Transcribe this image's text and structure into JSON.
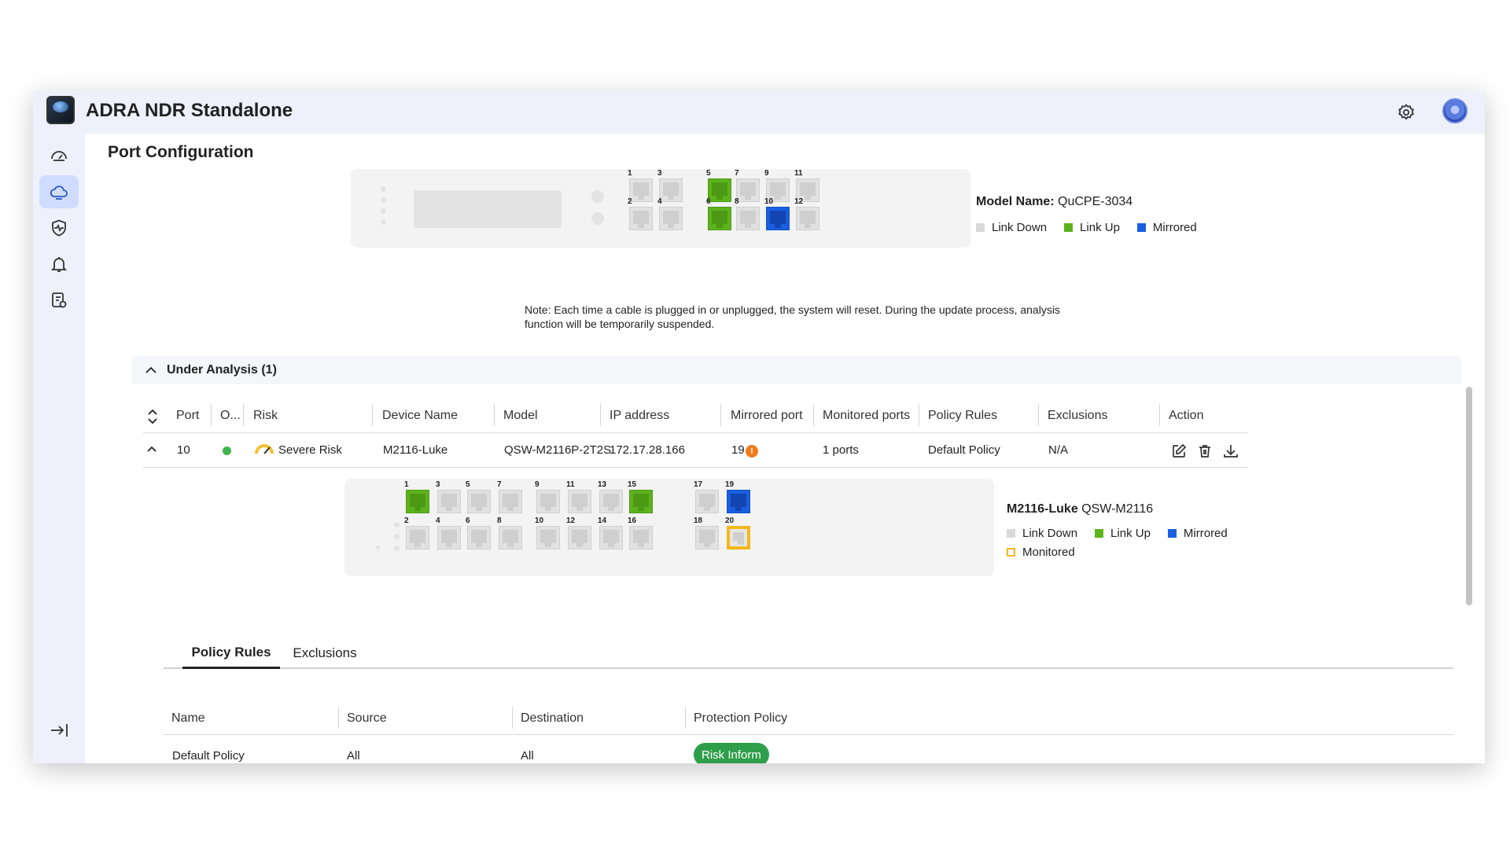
{
  "app": {
    "title": "ADRA NDR Standalone"
  },
  "icons": {
    "settings": "gear-icon",
    "sidebar": [
      "dashboard-gauge-icon",
      "cloud-icon",
      "shield-heartbeat-icon",
      "bell-icon",
      "report-settings-icon"
    ],
    "collapse": "expand-sidebar-icon"
  },
  "page": {
    "title": "Port Configuration"
  },
  "device": {
    "model_label": "Model Name:",
    "model_value": "QuCPE-3034",
    "ports": [
      {
        "num": "1",
        "state": "down"
      },
      {
        "num": "2",
        "state": "down"
      },
      {
        "num": "3",
        "state": "down"
      },
      {
        "num": "4",
        "state": "down"
      },
      {
        "num": "5",
        "state": "up"
      },
      {
        "num": "6",
        "state": "up"
      },
      {
        "num": "7",
        "state": "down"
      },
      {
        "num": "8",
        "state": "down"
      },
      {
        "num": "9",
        "state": "down"
      },
      {
        "num": "10",
        "state": "mirrored"
      },
      {
        "num": "11",
        "state": "down"
      },
      {
        "num": "12",
        "state": "down"
      }
    ]
  },
  "legend": {
    "link_down": "Link Down",
    "link_up": "Link Up",
    "mirrored": "Mirrored",
    "monitored": "Monitored"
  },
  "colors": {
    "link_down": "#d9d9d9",
    "link_up": "#5cb31d",
    "mirrored": "#1a5fe0",
    "monitored": "#f4b81c",
    "risk_inform": "#2e9e4a",
    "status_online": "#3eb54a",
    "warning": "#f07a1c"
  },
  "note": "Note: Each time a cable is plugged in or unplugged, the system will reset. During the update process, analysis function will be temporarily suspended.",
  "analysis": {
    "title": "Under Analysis (1)",
    "columns": [
      "Port",
      "O...",
      "Risk",
      "Device Name",
      "Model",
      "IP address",
      "Mirrored port",
      "Monitored ports",
      "Policy Rules",
      "Exclusions",
      "Action"
    ],
    "row": {
      "port": "10",
      "risk": "Severe Risk",
      "device_name": "M2116-Luke",
      "model": "QSW-M2116P-2T2S",
      "ip": "172.17.28.166",
      "mirrored_port": "19",
      "warning_mark": "!",
      "monitored_ports": "1 ports",
      "policy_rules": "Default Policy",
      "exclusions": "N/A",
      "actions": [
        "edit-icon",
        "trash-icon",
        "download-icon"
      ]
    }
  },
  "switch": {
    "name": "M2116-Luke",
    "model": "QSW-M2116",
    "ports": [
      {
        "num": "1",
        "state": "up"
      },
      {
        "num": "2",
        "state": "down"
      },
      {
        "num": "3",
        "state": "down"
      },
      {
        "num": "4",
        "state": "down"
      },
      {
        "num": "5",
        "state": "down"
      },
      {
        "num": "6",
        "state": "down"
      },
      {
        "num": "7",
        "state": "down"
      },
      {
        "num": "8",
        "state": "down"
      },
      {
        "num": "9",
        "state": "down"
      },
      {
        "num": "10",
        "state": "down"
      },
      {
        "num": "11",
        "state": "down"
      },
      {
        "num": "12",
        "state": "down"
      },
      {
        "num": "13",
        "state": "down"
      },
      {
        "num": "14",
        "state": "down"
      },
      {
        "num": "15",
        "state": "up"
      },
      {
        "num": "16",
        "state": "down"
      },
      {
        "num": "17",
        "state": "down"
      },
      {
        "num": "18",
        "state": "down"
      },
      {
        "num": "19",
        "state": "mirrored"
      },
      {
        "num": "20",
        "state": "monitored"
      }
    ]
  },
  "tabs": [
    "Policy Rules",
    "Exclusions"
  ],
  "active_tab": "Policy Rules",
  "policy_table": {
    "columns": [
      "Name",
      "Source",
      "Destination",
      "Protection Policy"
    ],
    "rows": [
      {
        "name": "Default Policy",
        "source": "All",
        "destination": "All",
        "protection_policy": "Risk Inform"
      }
    ]
  }
}
